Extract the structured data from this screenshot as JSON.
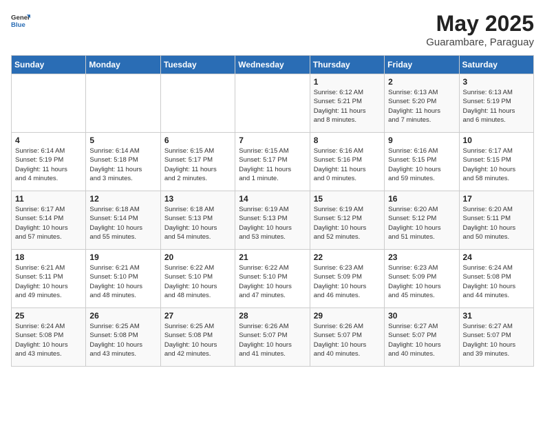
{
  "header": {
    "logo_general": "General",
    "logo_blue": "Blue",
    "title": "May 2025",
    "location": "Guarambare, Paraguay"
  },
  "weekdays": [
    "Sunday",
    "Monday",
    "Tuesday",
    "Wednesday",
    "Thursday",
    "Friday",
    "Saturday"
  ],
  "weeks": [
    [
      {
        "day": "",
        "detail": ""
      },
      {
        "day": "",
        "detail": ""
      },
      {
        "day": "",
        "detail": ""
      },
      {
        "day": "",
        "detail": ""
      },
      {
        "day": "1",
        "detail": "Sunrise: 6:12 AM\nSunset: 5:21 PM\nDaylight: 11 hours\nand 8 minutes."
      },
      {
        "day": "2",
        "detail": "Sunrise: 6:13 AM\nSunset: 5:20 PM\nDaylight: 11 hours\nand 7 minutes."
      },
      {
        "day": "3",
        "detail": "Sunrise: 6:13 AM\nSunset: 5:19 PM\nDaylight: 11 hours\nand 6 minutes."
      }
    ],
    [
      {
        "day": "4",
        "detail": "Sunrise: 6:14 AM\nSunset: 5:19 PM\nDaylight: 11 hours\nand 4 minutes."
      },
      {
        "day": "5",
        "detail": "Sunrise: 6:14 AM\nSunset: 5:18 PM\nDaylight: 11 hours\nand 3 minutes."
      },
      {
        "day": "6",
        "detail": "Sunrise: 6:15 AM\nSunset: 5:17 PM\nDaylight: 11 hours\nand 2 minutes."
      },
      {
        "day": "7",
        "detail": "Sunrise: 6:15 AM\nSunset: 5:17 PM\nDaylight: 11 hours\nand 1 minute."
      },
      {
        "day": "8",
        "detail": "Sunrise: 6:16 AM\nSunset: 5:16 PM\nDaylight: 11 hours\nand 0 minutes."
      },
      {
        "day": "9",
        "detail": "Sunrise: 6:16 AM\nSunset: 5:15 PM\nDaylight: 10 hours\nand 59 minutes."
      },
      {
        "day": "10",
        "detail": "Sunrise: 6:17 AM\nSunset: 5:15 PM\nDaylight: 10 hours\nand 58 minutes."
      }
    ],
    [
      {
        "day": "11",
        "detail": "Sunrise: 6:17 AM\nSunset: 5:14 PM\nDaylight: 10 hours\nand 57 minutes."
      },
      {
        "day": "12",
        "detail": "Sunrise: 6:18 AM\nSunset: 5:14 PM\nDaylight: 10 hours\nand 55 minutes."
      },
      {
        "day": "13",
        "detail": "Sunrise: 6:18 AM\nSunset: 5:13 PM\nDaylight: 10 hours\nand 54 minutes."
      },
      {
        "day": "14",
        "detail": "Sunrise: 6:19 AM\nSunset: 5:13 PM\nDaylight: 10 hours\nand 53 minutes."
      },
      {
        "day": "15",
        "detail": "Sunrise: 6:19 AM\nSunset: 5:12 PM\nDaylight: 10 hours\nand 52 minutes."
      },
      {
        "day": "16",
        "detail": "Sunrise: 6:20 AM\nSunset: 5:12 PM\nDaylight: 10 hours\nand 51 minutes."
      },
      {
        "day": "17",
        "detail": "Sunrise: 6:20 AM\nSunset: 5:11 PM\nDaylight: 10 hours\nand 50 minutes."
      }
    ],
    [
      {
        "day": "18",
        "detail": "Sunrise: 6:21 AM\nSunset: 5:11 PM\nDaylight: 10 hours\nand 49 minutes."
      },
      {
        "day": "19",
        "detail": "Sunrise: 6:21 AM\nSunset: 5:10 PM\nDaylight: 10 hours\nand 48 minutes."
      },
      {
        "day": "20",
        "detail": "Sunrise: 6:22 AM\nSunset: 5:10 PM\nDaylight: 10 hours\nand 48 minutes."
      },
      {
        "day": "21",
        "detail": "Sunrise: 6:22 AM\nSunset: 5:10 PM\nDaylight: 10 hours\nand 47 minutes."
      },
      {
        "day": "22",
        "detail": "Sunrise: 6:23 AM\nSunset: 5:09 PM\nDaylight: 10 hours\nand 46 minutes."
      },
      {
        "day": "23",
        "detail": "Sunrise: 6:23 AM\nSunset: 5:09 PM\nDaylight: 10 hours\nand 45 minutes."
      },
      {
        "day": "24",
        "detail": "Sunrise: 6:24 AM\nSunset: 5:08 PM\nDaylight: 10 hours\nand 44 minutes."
      }
    ],
    [
      {
        "day": "25",
        "detail": "Sunrise: 6:24 AM\nSunset: 5:08 PM\nDaylight: 10 hours\nand 43 minutes."
      },
      {
        "day": "26",
        "detail": "Sunrise: 6:25 AM\nSunset: 5:08 PM\nDaylight: 10 hours\nand 43 minutes."
      },
      {
        "day": "27",
        "detail": "Sunrise: 6:25 AM\nSunset: 5:08 PM\nDaylight: 10 hours\nand 42 minutes."
      },
      {
        "day": "28",
        "detail": "Sunrise: 6:26 AM\nSunset: 5:07 PM\nDaylight: 10 hours\nand 41 minutes."
      },
      {
        "day": "29",
        "detail": "Sunrise: 6:26 AM\nSunset: 5:07 PM\nDaylight: 10 hours\nand 40 minutes."
      },
      {
        "day": "30",
        "detail": "Sunrise: 6:27 AM\nSunset: 5:07 PM\nDaylight: 10 hours\nand 40 minutes."
      },
      {
        "day": "31",
        "detail": "Sunrise: 6:27 AM\nSunset: 5:07 PM\nDaylight: 10 hours\nand 39 minutes."
      }
    ]
  ]
}
